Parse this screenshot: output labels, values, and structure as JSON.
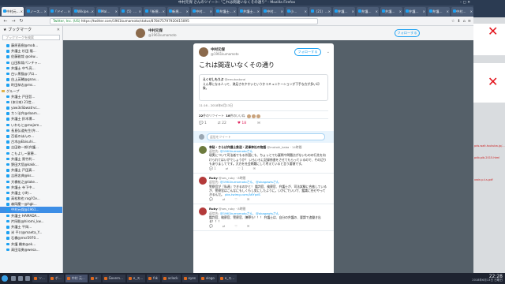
{
  "window": {
    "title": "中村元保 さんのツイート: \"これは間違いなくその通り\" - Mozilla Firefox"
  },
  "tabs": [
    {
      "label": "中村元…"
    },
    {
      "label": "ノース…"
    },
    {
      "label": "「ドイ…"
    },
    {
      "label": "Wikipe…"
    },
    {
      "label": "Mal…"
    },
    {
      "label": "（5）…"
    },
    {
      "label": "「新規…"
    },
    {
      "label": "新規…"
    },
    {
      "label": "中村…"
    },
    {
      "label": "弁護士…"
    },
    {
      "label": "弁護士…"
    },
    {
      "label": "中村…"
    },
    {
      "label": "小…"
    },
    {
      "label": "（21）…"
    },
    {
      "label": "弁護…"
    },
    {
      "label": "弁護…"
    },
    {
      "label": "弁護…"
    },
    {
      "label": "弁護…"
    },
    {
      "label": "弁護…"
    },
    {
      "label": "中村…"
    },
    {
      "label": "（3）…"
    }
  ],
  "navbar": {
    "back": "←",
    "forward": "→",
    "reload": "↻",
    "url_secure": "Twitter, Inc. (US)",
    "url": "https://twitter.com/1961kumamoto/status/878475797920415095"
  },
  "sidebar": {
    "title": "ブックマーク",
    "search_placeholder": "ブックマークを検索",
    "items": [
      {
        "label": "藤原直樹@mob...",
        "type": "item"
      },
      {
        "label": "弁護士 杉田 隆...",
        "type": "item"
      },
      {
        "label": "佐藤雅哉 @okw...",
        "type": "item"
      },
      {
        "label": "山田和哉パンチャ...",
        "type": "item"
      },
      {
        "label": "弁護士 中*L亮...",
        "type": "item"
      },
      {
        "label": "白い黒猫@プロ...",
        "type": "item"
      },
      {
        "label": "白上英輔@gnav...",
        "type": "item"
      },
      {
        "label": "町田恭志@ms...",
        "type": "item"
      },
      {
        "label": "グループ",
        "type": "folder"
      },
      {
        "label": "弁護士 戸田哲...",
        "type": "item"
      },
      {
        "label": "(本)(本) 21世...",
        "type": "item"
      },
      {
        "label": "yaw3sSbwatrvc...",
        "type": "item"
      },
      {
        "label": "カン法弁@daam...",
        "type": "item"
      },
      {
        "label": "弁護士 鈴木博...",
        "type": "item"
      },
      {
        "label": "いわもと@mojem...",
        "type": "item"
      },
      {
        "label": "長島弘道先生(弁...",
        "type": "item"
      },
      {
        "label": "百坂のほんの...",
        "type": "item"
      },
      {
        "label": "古木@Ebisuhi...",
        "type": "item"
      },
      {
        "label": "吉田修一郎(弁護...",
        "type": "item"
      },
      {
        "label": "こもよし~意穂...",
        "type": "item"
      },
      {
        "label": "弁護士 黒竹利...",
        "type": "item"
      },
      {
        "label": "野田大悟@kakk...",
        "type": "item"
      },
      {
        "label": "弁護士 戸田真...",
        "type": "item"
      },
      {
        "label": "吉原忠典@ks...",
        "type": "item"
      },
      {
        "label": "大橋祐之@take...",
        "type": "item"
      },
      {
        "label": "弁護士 寺下中...",
        "type": "item"
      },
      {
        "label": "弁護士 小町...",
        "type": "item"
      },
      {
        "label": "高松和也 rogi'Ov...",
        "type": "item"
      },
      {
        "label": "森岡慶一@hgk...",
        "type": "item"
      },
      {
        "label": "中村元保@1961...",
        "type": "selected"
      },
      {
        "label": "弁護士 HAMADA...",
        "type": "item"
      },
      {
        "label": "片岡聡@hiromi_kw...",
        "type": "item"
      },
      {
        "label": "弁護士 平岡...",
        "type": "item"
      },
      {
        "label": "米 平川@maeta_Y...",
        "type": "item"
      },
      {
        "label": "石橋@msr5970...",
        "type": "item"
      },
      {
        "label": "弁護 橋本@ek...",
        "type": "item"
      },
      {
        "label": "高田浩勇@wesa...",
        "type": "item"
      }
    ]
  },
  "profile": {
    "name": "中村元保",
    "handle": "@1961kumamoto",
    "follow_label": "フォローする"
  },
  "tweet": {
    "name": "中村元保",
    "handle": "@1961kumamoto",
    "follow_label": "フォローする",
    "text": "これは間違いなくその通り",
    "quote_name": "えくせしもうぶ",
    "quote_handle": "@emutostorai",
    "quote_text": "えん罪になる人って、満足されやすいというかコミュニケーションが下手な方が多い印象。",
    "timestamp": "11:16 - 2018年6月13日",
    "retweets_count": "22",
    "retweets_label": "件のリツイート",
    "likes_count": "18",
    "likes_label": "件のいいね",
    "reply_count": "1",
    "rt_count": "22",
    "like_count": "18"
  },
  "reply_box": {
    "placeholder": "返信をツイート"
  },
  "replies": [
    {
      "name": "幸秘・さらば弁護士鉄道・泥棒神社の物語",
      "handle": "@motoki_kaba",
      "time": "· 14時間",
      "to_label": "返信先:",
      "to": "@1961kumamotoさん",
      "body": "現実について司法者でもる外国にも、ちょっとでも疑問や問題点がないものの行先を向けられてはいがでしょうか？ いろいろに記録係書をさせてもらっているので、その辺りもありましてです。大方を社会問題にして考えていると言う要領です。",
      "avatar_color": "#6c7a3d",
      "reply_count": "1",
      "rt_count": "",
      "like_count": "1"
    },
    {
      "name": "Ruby",
      "handle": "@ses_ruby",
      "time": "· 8時間",
      "to_label": "返信先:",
      "to": "@1961kumamotoさん、@okagawtsさん",
      "body": "警察官が『私達』できるのかと！ 鑑判官、検察官、弁護士が、司法試験に合格しているが、警察官はこんなにもしくもし気にしたように。いかにでいいで、鑑識に任せやってきるんだ。",
      "link": "pbs.twimg.com/A6YpdS",
      "avatar_color": "#b33a3a",
      "reply_count": "",
      "rt_count": "",
      "like_count": ""
    },
    {
      "name": "Ruby",
      "handle": "@ses_ruby",
      "time": "· 8時間",
      "to_label": "返信先:",
      "to": "@1961kumamotoさん、@okagawtsさん",
      "body": "鑑判官、検察官、警察官、陳罪も！！！ 弁護士は、自分の弁護の、要請で追働き出る！！！",
      "avatar_color": "#b33a3a",
      "reply_count": "",
      "rt_count": "",
      "like_count": ""
    }
  ],
  "right_strip": {
    "text1": "pds.wait.tsukuba.jp/...",
    "text2": "pdb.pib.2015.html",
    "text3": "xwin.p.t.s.pdf"
  },
  "taskbar": {
    "tasks": [
      {
        "label": "ソ..."
      },
      {
        "label": "ボ..."
      },
      {
        "label": "中村 元..."
      },
      {
        "label": "e:"
      },
      {
        "label": "Govern..."
      },
      {
        "label": "e_ス..."
      },
      {
        "label": "fsk"
      },
      {
        "label": "xclock"
      },
      {
        "label": "eyes"
      },
      {
        "label": "xlogo"
      },
      {
        "label": "e_ス..."
      }
    ],
    "time": "22:28",
    "date": "2018年6月13日 日曜日"
  }
}
